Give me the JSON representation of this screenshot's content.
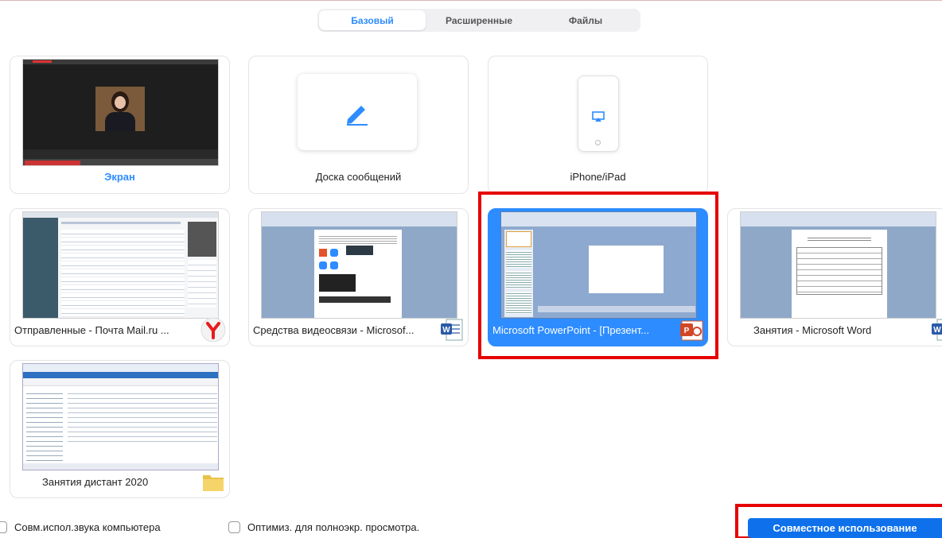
{
  "tabs": [
    {
      "label": "Базовый",
      "active": true
    },
    {
      "label": "Расширенные",
      "active": false
    },
    {
      "label": "Файлы",
      "active": false
    }
  ],
  "tiles": {
    "screen": {
      "label": "Экран"
    },
    "whiteboard": {
      "label": "Доска сообщений"
    },
    "iphone": {
      "label": "iPhone/iPad"
    },
    "mail": {
      "label": "Отправленные - Почта Mail.ru ...",
      "app_icon": "yandex-browser-icon"
    },
    "word_video": {
      "label": "Средства видеосвязи - Microsof...",
      "app_icon": "word-icon"
    },
    "powerpoint": {
      "label": "Microsoft PowerPoint - [Презент...",
      "app_icon": "powerpoint-icon",
      "selected": true
    },
    "word_lessons": {
      "label": "Занятия - Microsoft Word",
      "app_icon": "word-icon"
    },
    "folder": {
      "label": "Занятия дистант 2020",
      "app_icon": "folder-icon"
    }
  },
  "options": {
    "share_audio": "Совм.испол.звука компьютера",
    "optimize_video": "Оптимиз. для полноэкр. просмотра."
  },
  "share_button": "Совместное использование",
  "colors": {
    "accent": "#2d8cff",
    "button": "#0e71eb",
    "highlight": "#e60000"
  }
}
